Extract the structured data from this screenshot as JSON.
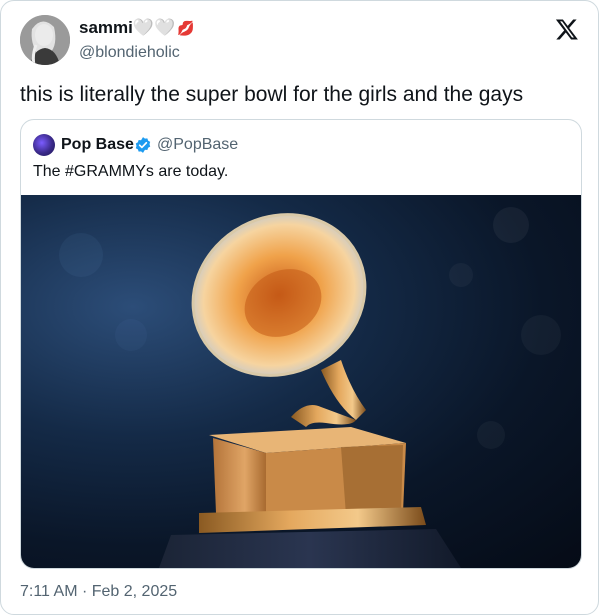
{
  "author": {
    "display_name": "sammi🤍🤍",
    "emoji": "💋",
    "handle": "@blondieholic",
    "avatar_icon": "profile-photo"
  },
  "platform_icon": "x-logo-icon",
  "tweet": {
    "text": "this is literally the super bowl for the girls and the gays",
    "timestamp": "7:11 AM · Feb 2, 2025"
  },
  "quoted_tweet": {
    "display_name": "Pop Base",
    "handle": "@PopBase",
    "verified": true,
    "verified_color": "#1d9bf0",
    "text": "The #GRAMMYs are today.",
    "media_icon": "grammy-trophy-image"
  },
  "colors": {
    "border": "#cfd9de",
    "secondary_text": "#536471",
    "primary_text": "#0f1419"
  }
}
